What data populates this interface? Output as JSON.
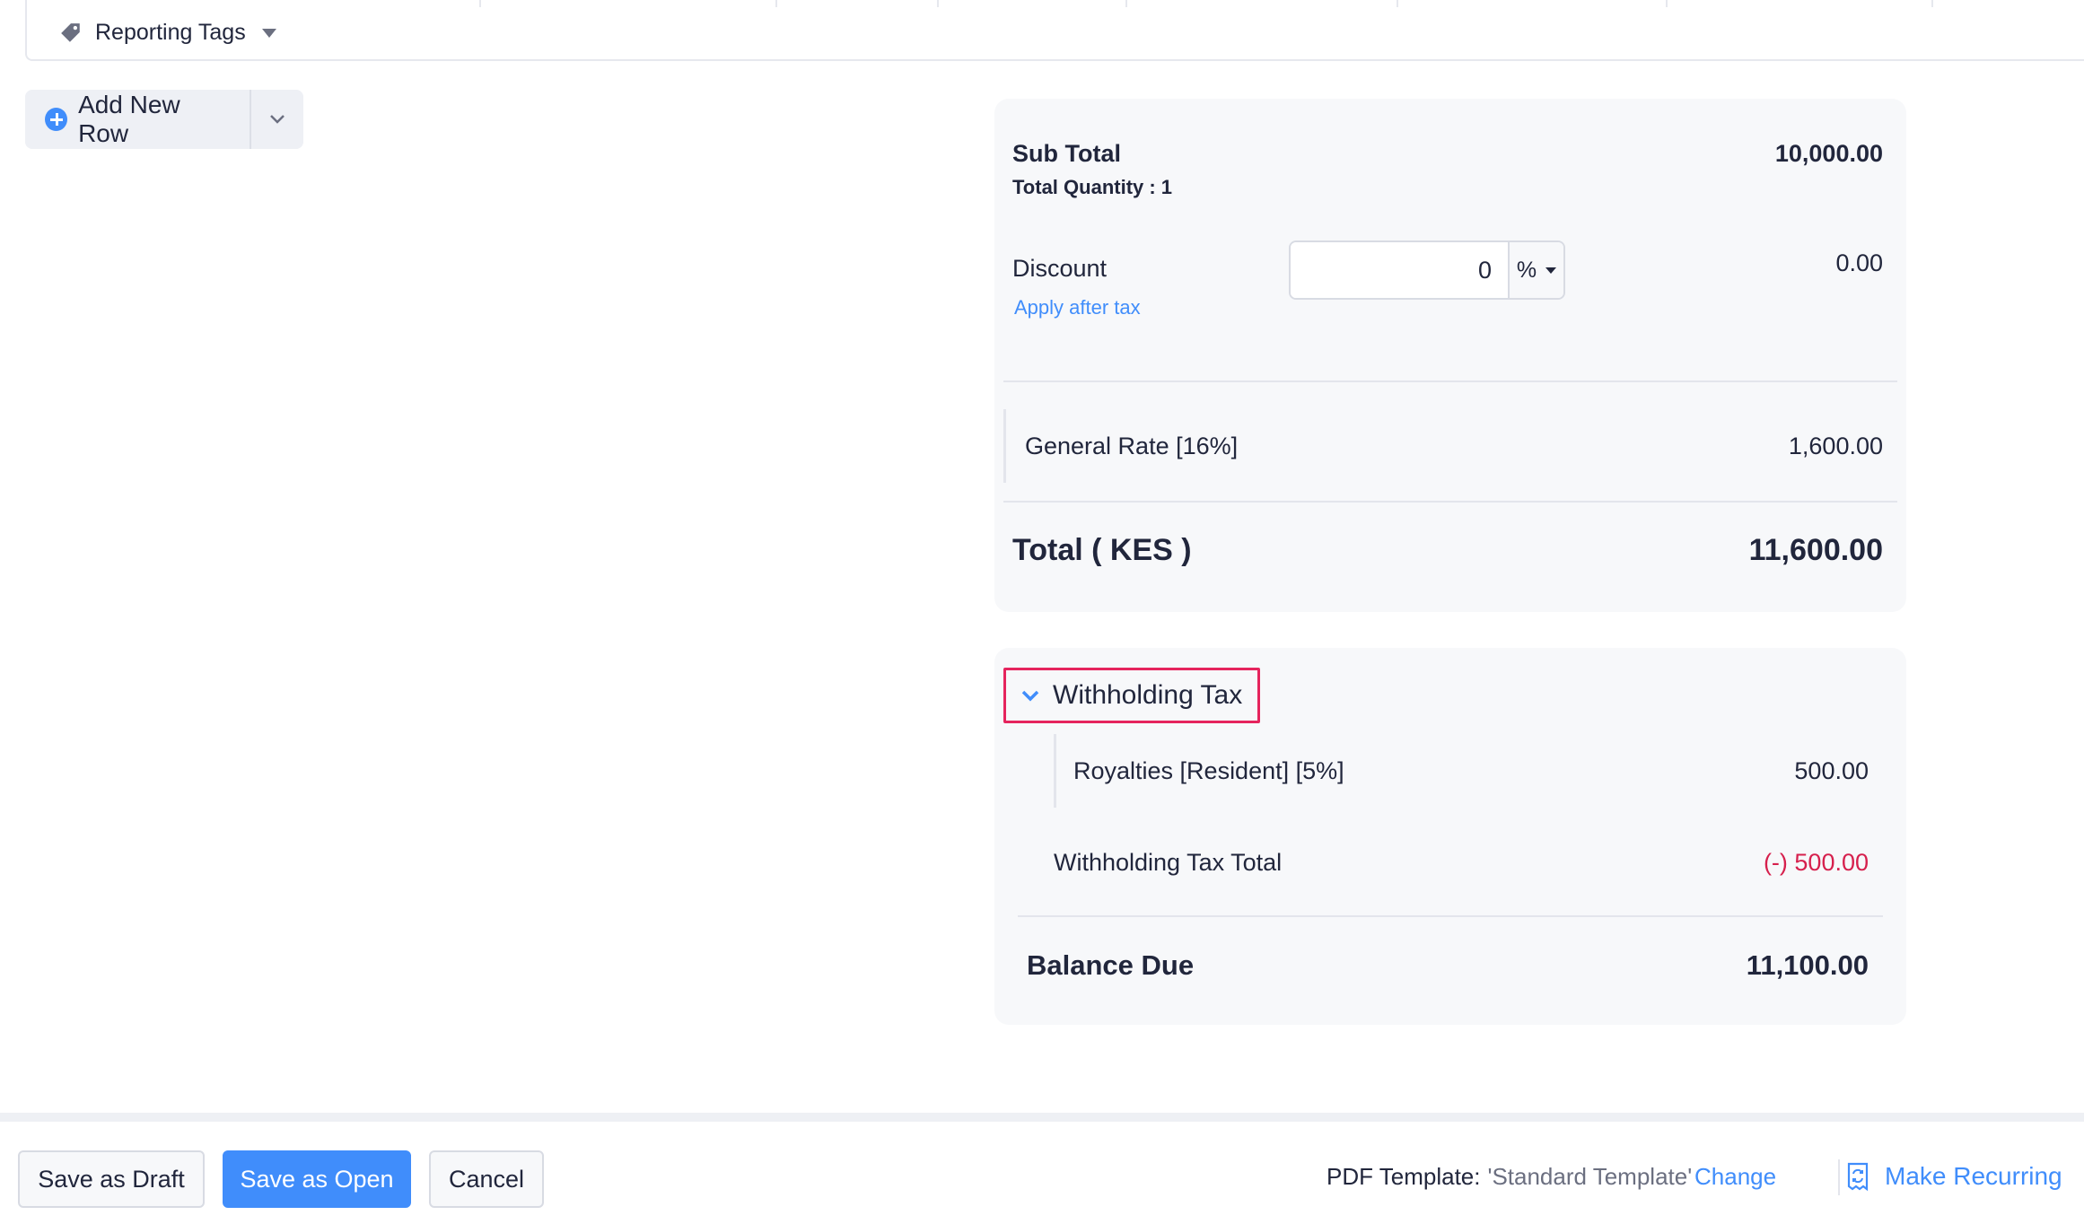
{
  "items_table": {
    "reporting_tags_label": "Reporting Tags"
  },
  "add_row": {
    "label": "Add New Row"
  },
  "totals": {
    "sub_total_label": "Sub Total",
    "sub_total_value": "10,000.00",
    "total_quantity_label": "Total Quantity : 1",
    "discount_label": "Discount",
    "discount_input_value": "0",
    "discount_unit": "%",
    "discount_value": "0.00",
    "apply_after_tax_label": "Apply after tax",
    "tax_label": "General Rate [16%]",
    "tax_value": "1,600.00",
    "total_label": "Total ( KES )",
    "total_value": "11,600.00"
  },
  "withholding": {
    "toggle_label": "Withholding Tax",
    "item_label": "Royalties [Resident] [5%]",
    "item_value": "500.00",
    "total_label": "Withholding Tax Total",
    "total_value": "(-) 500.00",
    "balance_label": "Balance Due",
    "balance_value": "11,100.00"
  },
  "footer": {
    "save_draft_label": "Save as Draft",
    "save_open_label": "Save as Open",
    "cancel_label": "Cancel",
    "pdf_template_label": "PDF Template:",
    "pdf_template_value": "'Standard Template'",
    "change_label": "Change",
    "make_recurring_label": "Make Recurring"
  },
  "colors": {
    "accent": "#408dfb",
    "highlight_border": "#e5245d",
    "negative": "#d6204d",
    "card_bg": "#f7f8fa"
  },
  "icons": [
    "tag-icon",
    "caret-down-icon",
    "plus-circle-icon",
    "chevron-down-icon",
    "recurring-icon"
  ]
}
